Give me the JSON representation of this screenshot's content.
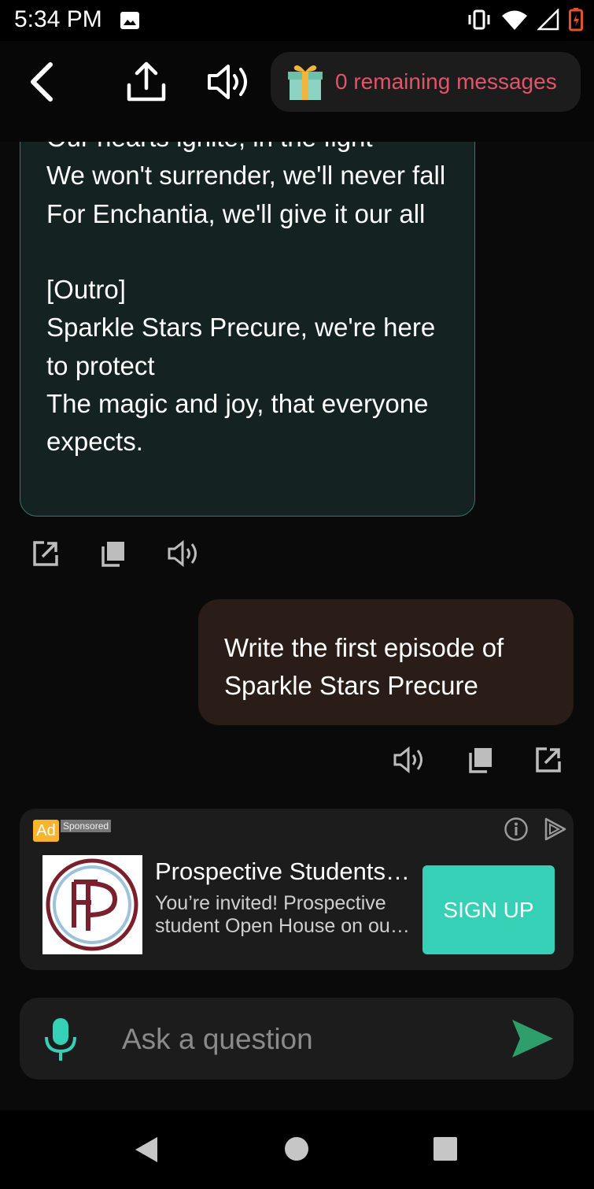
{
  "status_bar": {
    "time": "5:34 PM"
  },
  "header": {
    "remaining_messages": "0 remaining messages"
  },
  "chat": {
    "bot_message_lines": [
      "Our hearts ignite, in the fight",
      "We won't surrender, we'll never fall",
      "For Enchantia, we'll give it our all",
      "",
      "[Outro]",
      "Sparkle Stars Precure, we're here",
      "to protect",
      "The magic and joy, that everyone",
      "expects."
    ],
    "user_message": "Write the first episode of Sparkle Stars Precure"
  },
  "ad": {
    "badge": "Ad",
    "sponsored": "Sponsored",
    "title": "Prospective Students…",
    "description_line1": "You’re invited! Prospective",
    "description_line2": "student Open House on our…",
    "cta": "SIGN UP"
  },
  "input": {
    "placeholder": "Ask a question"
  },
  "colors": {
    "accent_teal": "#36d0b6",
    "send_green": "#2e9e6a",
    "remaining_red": "#e0556a",
    "bot_bubble_bg": "#142321",
    "user_bubble_bg": "#2a1c16"
  }
}
